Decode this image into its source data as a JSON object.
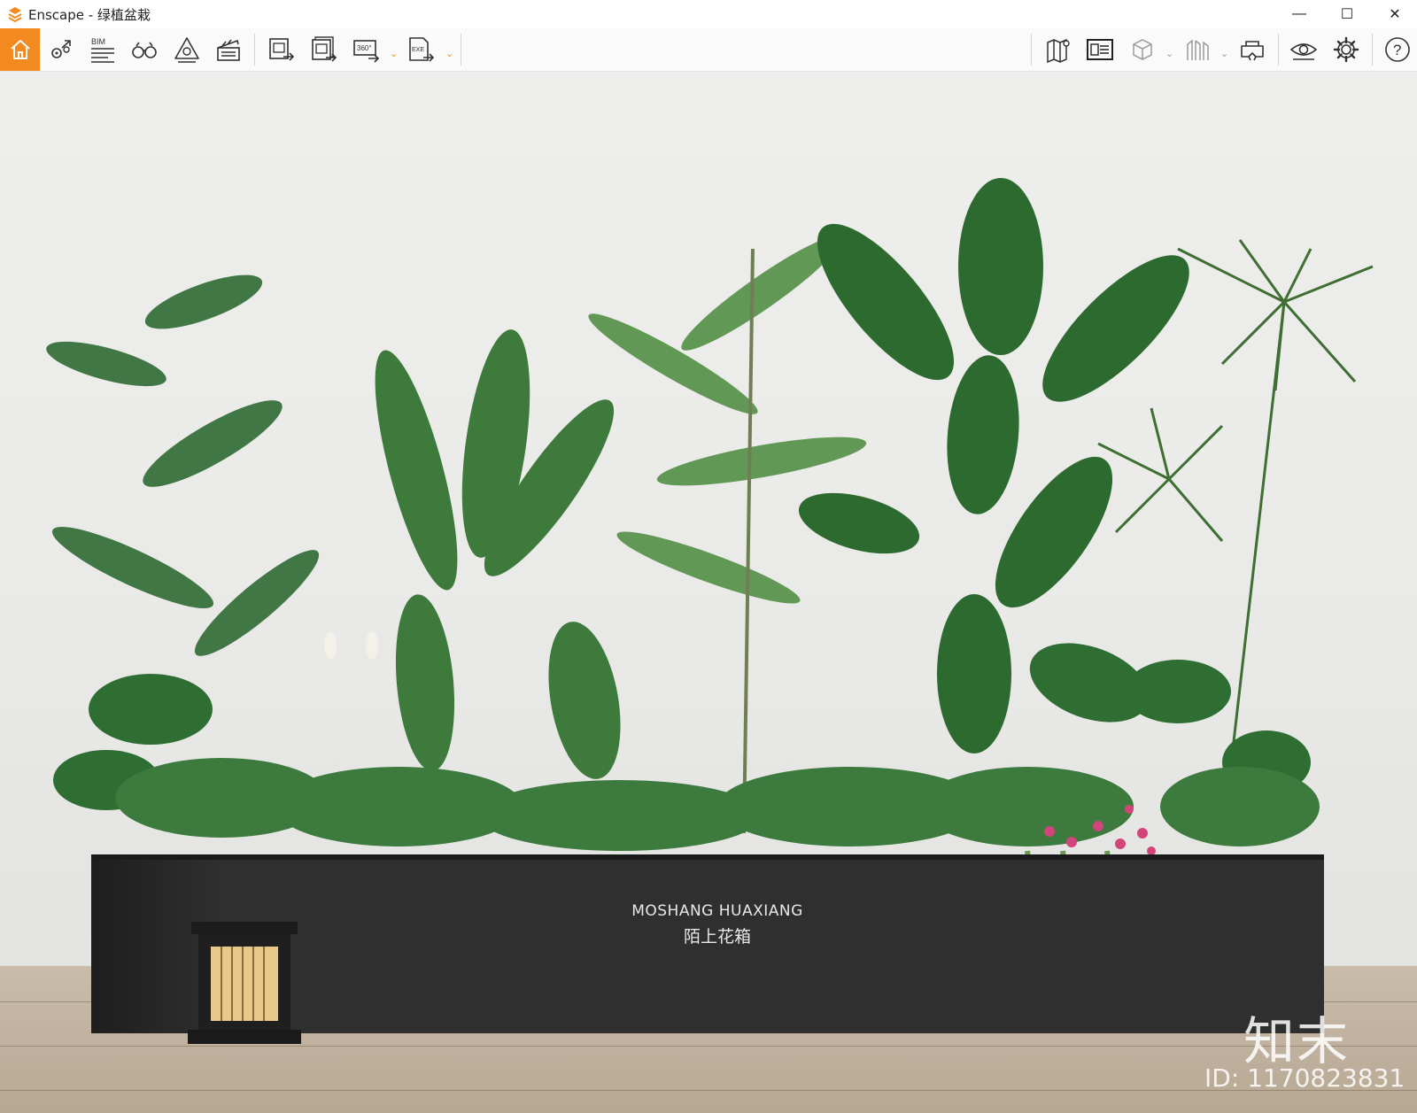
{
  "window": {
    "app_name": "Enscape",
    "title": "Enscape - 绿植盆栽",
    "controls": {
      "minimize": "—",
      "maximize": "☐",
      "close": "✕"
    }
  },
  "toolbar": {
    "accent_color": "#f28a1f",
    "left_buttons": [
      {
        "name": "home",
        "icon": "home-icon"
      },
      {
        "name": "views",
        "icon": "location-pin-icon"
      },
      {
        "name": "bim",
        "icon": "bim-icon",
        "label": "BIM"
      },
      {
        "name": "binoculars",
        "icon": "binoculars-icon"
      },
      {
        "name": "assets",
        "icon": "asset-library-icon"
      },
      {
        "name": "video",
        "icon": "clapperboard-icon"
      },
      {
        "name": "screenshot",
        "icon": "screenshot-export-icon"
      },
      {
        "name": "batch-render",
        "icon": "batch-render-icon"
      },
      {
        "name": "panorama",
        "icon": "panorama-360-icon",
        "label": "360°"
      },
      {
        "name": "exe-export",
        "icon": "exe-export-icon",
        "label": "EXE"
      }
    ],
    "right_buttons": [
      {
        "name": "map",
        "icon": "map-icon"
      },
      {
        "name": "minimap",
        "icon": "minimap-icon"
      },
      {
        "name": "cube",
        "icon": "cube-icon"
      },
      {
        "name": "library",
        "icon": "library-icon"
      },
      {
        "name": "vr",
        "icon": "vr-headset-icon"
      },
      {
        "name": "visual-settings",
        "icon": "eye-icon"
      },
      {
        "name": "settings",
        "icon": "gear-icon"
      },
      {
        "name": "help",
        "icon": "help-icon",
        "label": "?"
      }
    ]
  },
  "viewport": {
    "planter_text_en": "MOSHANG HUAXIANG",
    "planter_text_cn": "陌上花箱",
    "watermark_logo": "知末",
    "watermark_id": "ID: 1170823831"
  }
}
